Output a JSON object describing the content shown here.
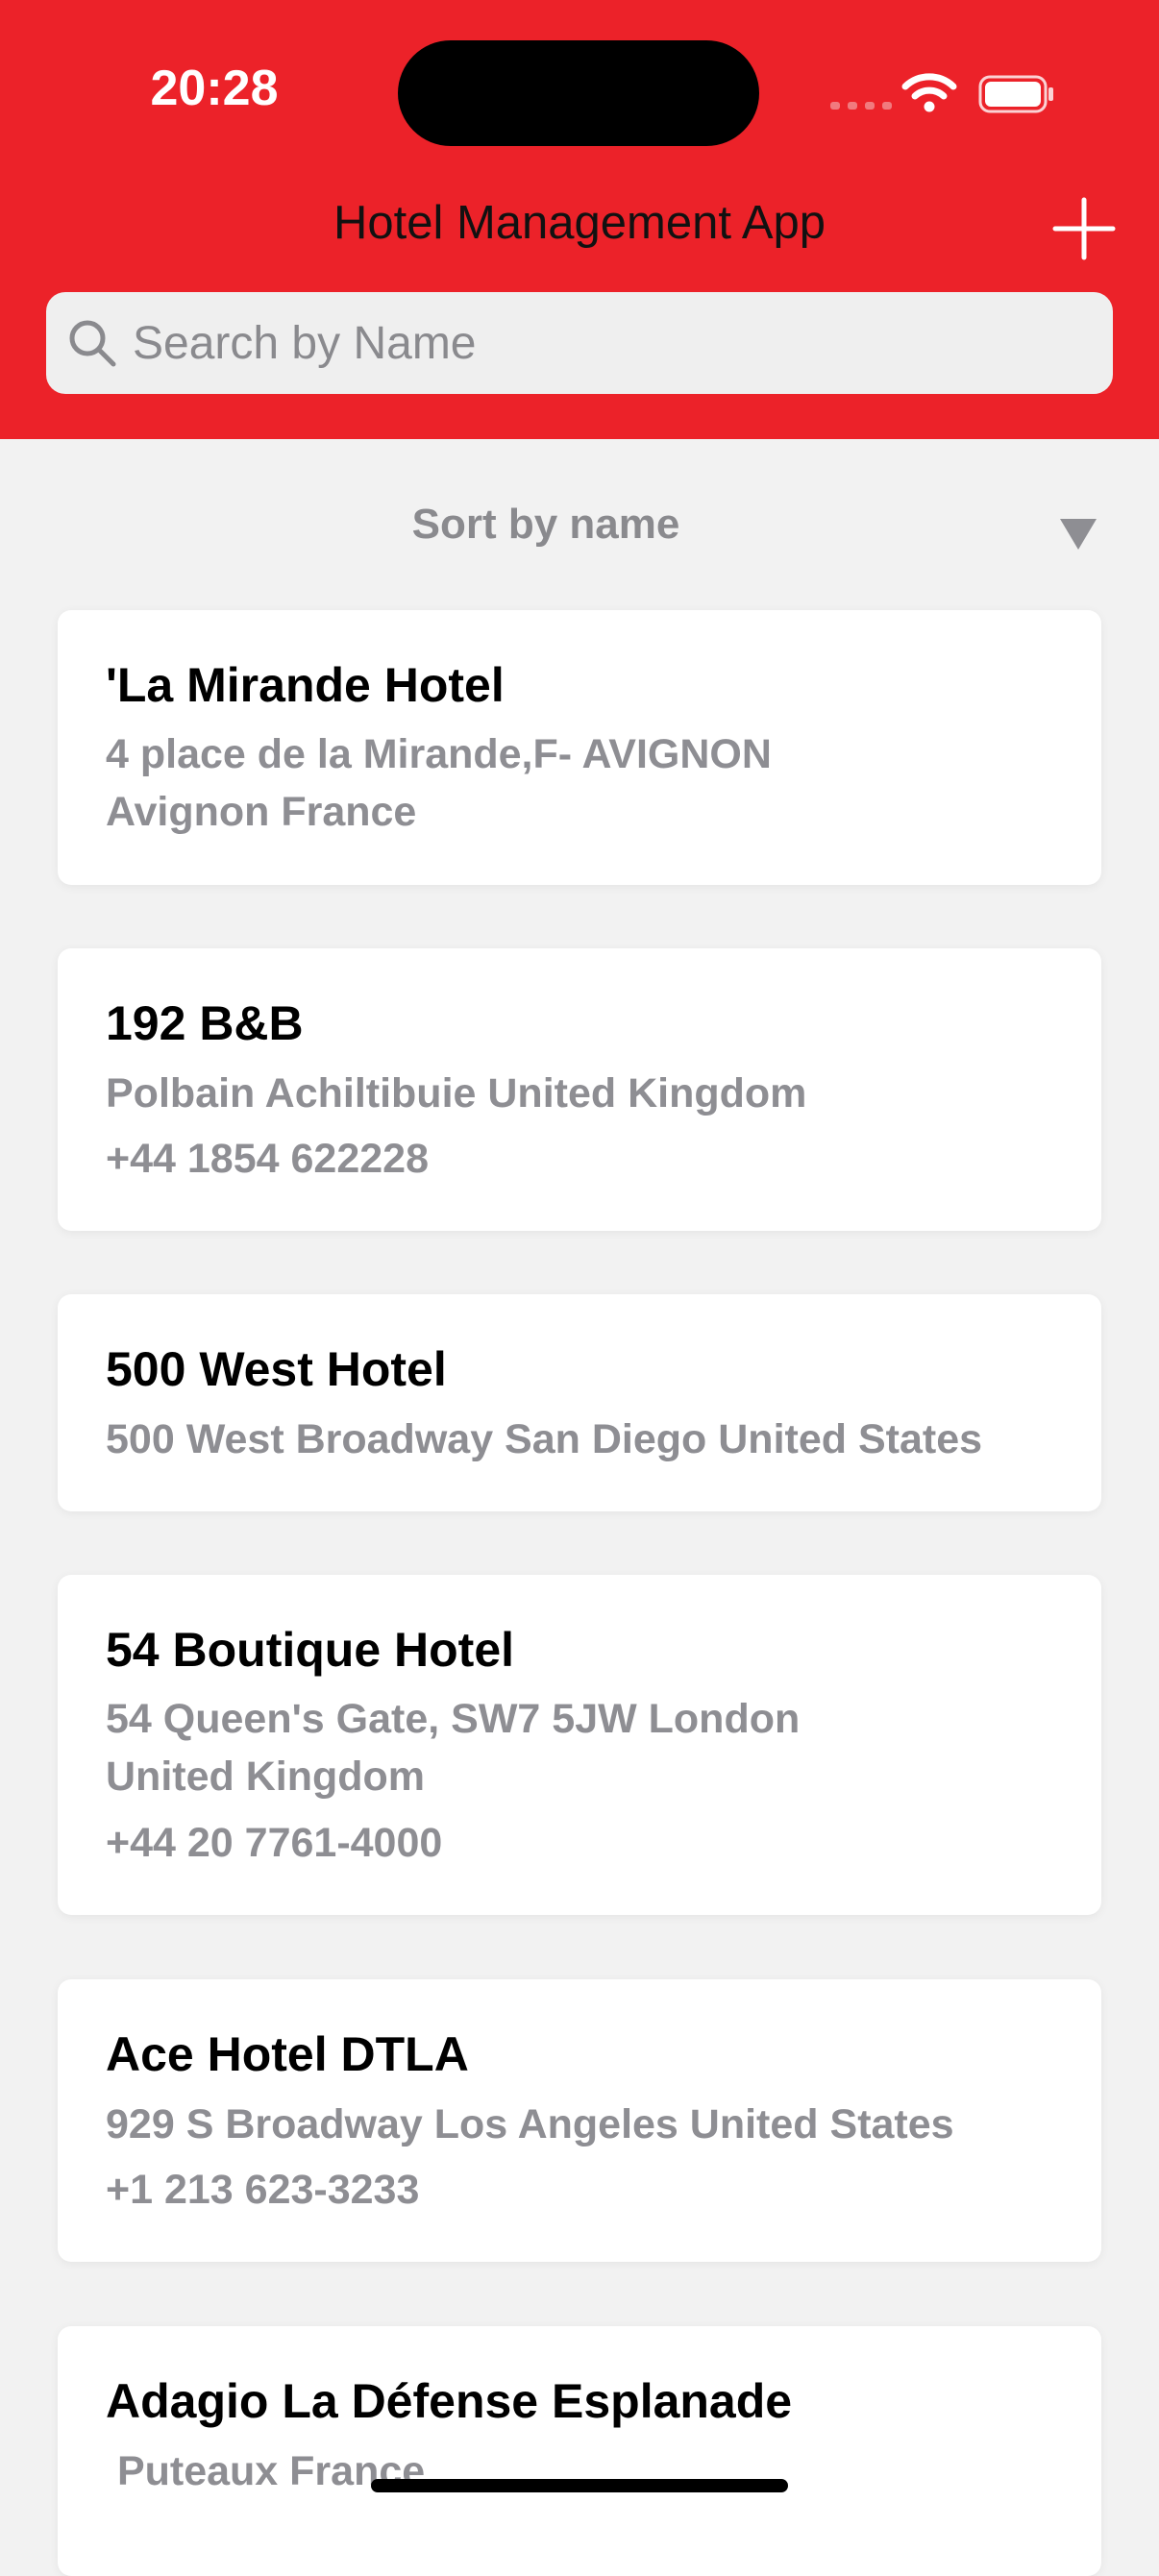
{
  "status_bar": {
    "time": "20:28"
  },
  "header": {
    "title": "Hotel Management App",
    "add_icon": "plus-icon",
    "accent_color": "#ec2229"
  },
  "search": {
    "placeholder": "Search by Name",
    "value": "",
    "icon": "search-icon"
  },
  "sort": {
    "label": "Sort by name",
    "icon": "triangle-down-icon"
  },
  "hotels": [
    {
      "name": "'La Mirande Hotel",
      "lines": [
        "4 place de la Mirande,F- AVIGNON",
        "Avignon France"
      ]
    },
    {
      "name": "192 B&B",
      "lines": [
        "Polbain Achiltibuie United Kingdom",
        "+44 1854 622228"
      ]
    },
    {
      "name": "500 West Hotel",
      "lines": [
        "500 West Broadway San Diego United States"
      ]
    },
    {
      "name": "54 Boutique Hotel",
      "lines": [
        "54 Queen's Gate, SW7 5JW London",
        "United Kingdom",
        "+44 20 7761-4000"
      ]
    },
    {
      "name": "Ace Hotel DTLA",
      "lines": [
        "929 S Broadway Los Angeles United States",
        "+1 213 623-3233"
      ]
    },
    {
      "name": "Adagio La Défense Esplanade",
      "lines": [
        " Puteaux France"
      ]
    }
  ]
}
